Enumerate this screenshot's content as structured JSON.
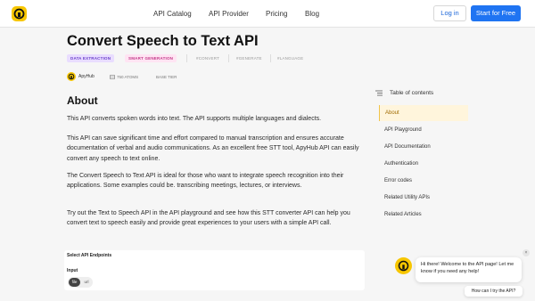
{
  "header": {
    "nav": [
      "API Catalog",
      "API Provider",
      "Pricing",
      "Blog"
    ],
    "login_label": "Log in",
    "start_label": "Start for Free"
  },
  "page": {
    "title": "Convert Speech to Text API",
    "tags": [
      "DATA EXTRACTION",
      "SMART GENERATION"
    ],
    "hashtags": [
      "#CONVERT",
      "#GENERATE",
      "#LANGUAGE"
    ],
    "provider": "ApyHub",
    "atoms": "750 ATOMS",
    "tier": "BASE TIER"
  },
  "about": {
    "heading": "About",
    "paragraphs": [
      "This API converts spoken words into text. The API supports multiple languages and dialects.",
      "This API can save significant time and effort compared to manual transcription and ensures accurate documentation of verbal and audio communications. As an excellent free STT tool, ApyHub API can easily convert any speech to text online.",
      "The Convert Speech to Text API is ideal for those who want to integrate speech recognition into their applications. Some examples could be. transcribing meetings, lectures, or interviews.",
      "Try out the Text to Speech API in the API playground and see how this STT converter API can help you convert text to speech easily and provide great experiences to your users with a simple API call."
    ]
  },
  "endpoints": {
    "title": "Select API Endpoints",
    "input_label": "Input",
    "options": [
      "file",
      "url"
    ],
    "selected": "file"
  },
  "toc": {
    "title": "Table of contents",
    "items": [
      "About",
      "API Playground",
      "API Documentation",
      "Authentication",
      "Error codes",
      "Related Utility APIs",
      "Related Articles"
    ],
    "active": "About"
  },
  "chat": {
    "message": "Hi there! Welcome to the API page! Let me know if you need any help!",
    "close": "×",
    "suggestion": "How can I try the API?"
  },
  "colors": {
    "brand_yellow": "#f7c600",
    "primary_blue": "#1f74f2"
  }
}
